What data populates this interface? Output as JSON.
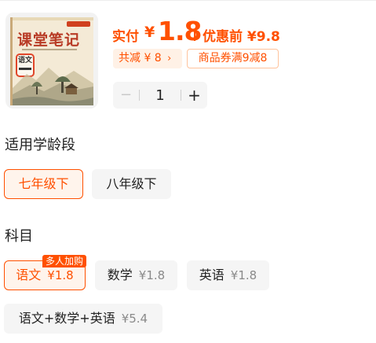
{
  "product": {
    "cover": {
      "title": "课堂笔记",
      "badge_text": "语文"
    },
    "price": {
      "label": "实付",
      "currency": "¥",
      "current": "1.8",
      "original_label": "优惠前 ¥9.8"
    },
    "promos": {
      "saving": "共减 ¥ 8",
      "coupon": "商品券满9减8"
    },
    "quantity": {
      "minus": "−",
      "value": "1",
      "plus": "+"
    }
  },
  "grade_section": {
    "title": "适用学龄段",
    "options": [
      {
        "label": "七年级下",
        "selected": true
      },
      {
        "label": "八年级下",
        "selected": false
      }
    ]
  },
  "subject_section": {
    "title": "科目",
    "options": [
      {
        "label": "语文",
        "price": "¥1.8",
        "selected": true,
        "badge": "多人加购"
      },
      {
        "label": "数学",
        "price": "¥1.8",
        "selected": false
      },
      {
        "label": "英语",
        "price": "¥1.8",
        "selected": false
      },
      {
        "label": "语文+数学+英语",
        "price": "¥5.4",
        "selected": false
      }
    ]
  },
  "colors": {
    "accent": "#ff5000",
    "selected_bg": "#fff4ec",
    "option_bg": "#f5f5f5"
  }
}
